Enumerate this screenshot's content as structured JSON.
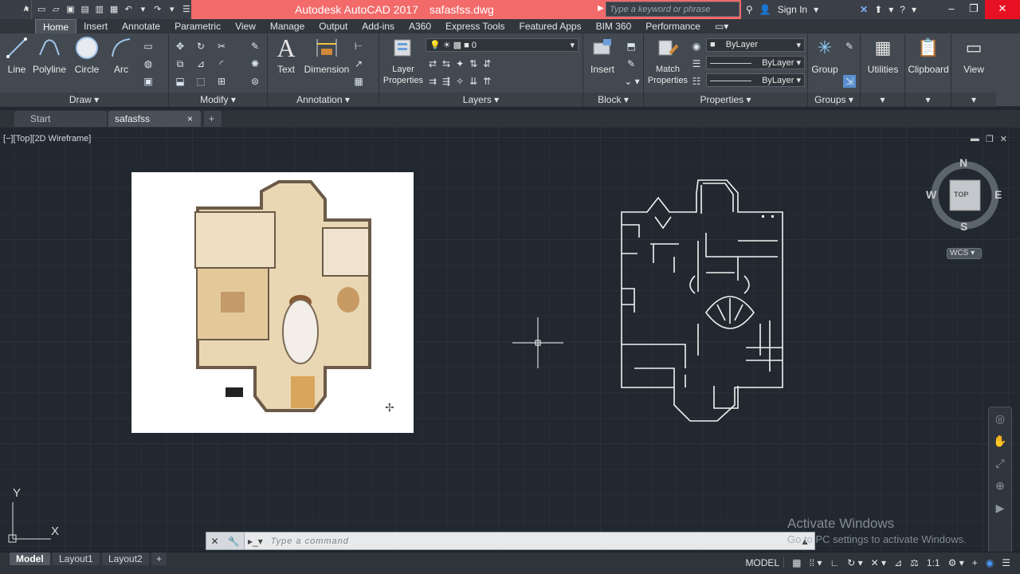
{
  "app": {
    "name": "Autodesk AutoCAD 2017",
    "file": "safasfss.dwg",
    "logo": "A",
    "logo_menu": "▾"
  },
  "search": {
    "placeholder": "Type a keyword or phrase"
  },
  "account": {
    "sign_in": "Sign In"
  },
  "ribbon_tabs": [
    "Home",
    "Insert",
    "Annotate",
    "Parametric",
    "View",
    "Manage",
    "Output",
    "Add-ins",
    "A360",
    "Express Tools",
    "Featured Apps",
    "BIM 360",
    "Performance"
  ],
  "panels": {
    "draw": {
      "title": "Draw",
      "line": "Line",
      "polyline": "Polyline",
      "circle": "Circle",
      "arc": "Arc"
    },
    "modify": {
      "title": "Modify"
    },
    "annotation": {
      "title": "Annotation",
      "text": "Text",
      "dimension": "Dimension"
    },
    "layers": {
      "title": "Layers",
      "layer_props": "Layer Properties",
      "current_layer": "0"
    },
    "block": {
      "title": "Block",
      "insert": "Insert"
    },
    "properties": {
      "title": "Properties",
      "match": "Match Properties",
      "color": "ByLayer",
      "linetype": "ByLayer",
      "lineweight": "ByLayer"
    },
    "groups": {
      "title": "Groups",
      "group": "Group"
    },
    "utilities": "Utilities",
    "clipboard": "Clipboard",
    "view": "View"
  },
  "doc_tabs": {
    "start": "Start",
    "current": "safasfss",
    "new": "+",
    "close": "×"
  },
  "viewport": {
    "label": "[−][Top][2D Wireframe]",
    "ucs_x": "X",
    "ucs_y": "Y"
  },
  "viewcube": {
    "n": "N",
    "s": "S",
    "e": "E",
    "w": "W",
    "face": "TOP",
    "wcs": "WCS"
  },
  "command": {
    "placeholder": "Type a command"
  },
  "watermark": {
    "line1": "Activate Windows",
    "line2": "Go to PC settings to activate Windows."
  },
  "layout_tabs": [
    "Model",
    "Layout1",
    "Layout2",
    "+"
  ],
  "status": {
    "model": "MODEL",
    "scale": "1:1"
  }
}
